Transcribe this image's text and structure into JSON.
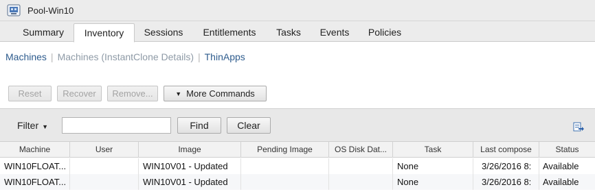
{
  "window": {
    "title": "Pool-Win10"
  },
  "tabs": [
    {
      "label": "Summary"
    },
    {
      "label": "Inventory",
      "active": true
    },
    {
      "label": "Sessions"
    },
    {
      "label": "Entitlements"
    },
    {
      "label": "Tasks"
    },
    {
      "label": "Events"
    },
    {
      "label": "Policies"
    }
  ],
  "subnav": {
    "machines": "Machines",
    "instantclone": "Machines (InstantClone Details)",
    "thinapps": "ThinApps"
  },
  "toolbar": {
    "reset": "Reset",
    "recover": "Recover",
    "remove": "Remove...",
    "more_commands": "More Commands"
  },
  "filter": {
    "label": "Filter",
    "value": "",
    "find": "Find",
    "clear": "Clear"
  },
  "table": {
    "columns": [
      "Machine",
      "User",
      "Image",
      "Pending Image",
      "OS Disk Dat...",
      "Task",
      "Last compose",
      "Status"
    ],
    "rows": [
      [
        "WIN10FLOAT...",
        "",
        "WIN10V01 - Updated",
        "",
        "",
        "None",
        "3/26/2016 8:",
        "Available"
      ],
      [
        "WIN10FLOAT...",
        "",
        "WIN10V01 - Updated",
        "",
        "",
        "None",
        "3/26/2016 8:",
        "Available"
      ]
    ]
  },
  "colors": {
    "link": "#2d5b8d",
    "link_dim": "#8e9aa6",
    "chrome": "#ececec"
  }
}
